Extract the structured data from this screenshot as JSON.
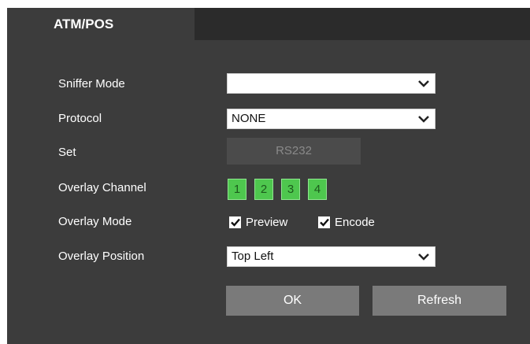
{
  "tab": {
    "label": "ATM/POS"
  },
  "sniffer_mode": {
    "label": "Sniffer Mode",
    "value": ""
  },
  "protocol": {
    "label": "Protocol",
    "value": "NONE"
  },
  "set": {
    "label": "Set",
    "button": "RS232"
  },
  "overlay_channel": {
    "label": "Overlay Channel",
    "channels": [
      "1",
      "2",
      "3",
      "4"
    ]
  },
  "overlay_mode": {
    "label": "Overlay Mode",
    "preview": "Preview",
    "encode": "Encode"
  },
  "overlay_position": {
    "label": "Overlay Position",
    "value": "Top Left"
  },
  "actions": {
    "ok": "OK",
    "refresh": "Refresh"
  }
}
